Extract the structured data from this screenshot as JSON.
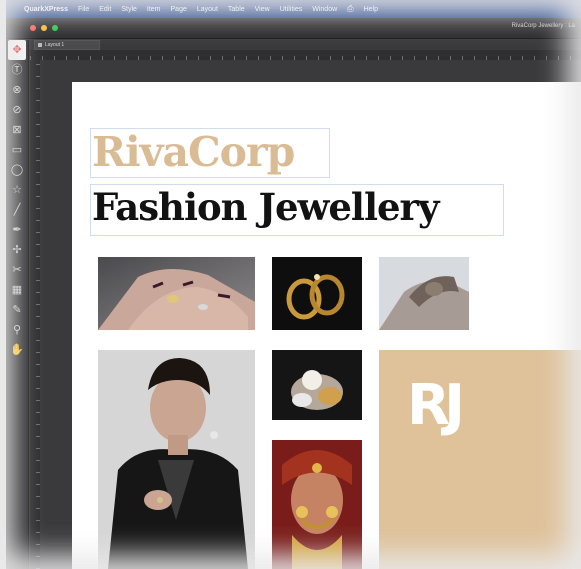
{
  "menubar": {
    "apple": "",
    "app_name": "QuarkXPress",
    "items": [
      "File",
      "Edit",
      "Style",
      "Item",
      "Page",
      "Layout",
      "Table",
      "View",
      "Utilities",
      "Window",
      "Help"
    ]
  },
  "window": {
    "title": "RivaCorp Jewellery : La",
    "layout_tab": "Layout 1"
  },
  "tools": [
    "move-tool",
    "text-content-tool",
    "text-linking-tool",
    "text-unlinking-tool",
    "picture-content-tool",
    "rectangle-box-tool",
    "oval-box-tool",
    "starburst-tool",
    "line-tool",
    "bezier-pen-tool",
    "add-point-tool",
    "scissors-tool",
    "table-tool",
    "eyedropper-tool",
    "zoom-tool",
    "hand-tool"
  ],
  "tool_glyphs": [
    "✥",
    "Ⓣ",
    "⊗",
    "⊘",
    "⊠",
    "▭",
    "◯",
    "☆",
    "╱",
    "✒",
    "✢",
    "✂",
    "▦",
    "✎",
    "⚲",
    "✋"
  ],
  "document": {
    "title_line1": "RivaCorp",
    "title_line2": "Fashion Jewellery",
    "brand_mark": "RJ"
  },
  "colors": {
    "menubar": "#1f3f86",
    "accent_beige": "#dfc29a",
    "title_beige": "#d9bb94",
    "close": "#ff5f56",
    "minimize": "#ffbd2e",
    "zoom": "#27c93f"
  }
}
